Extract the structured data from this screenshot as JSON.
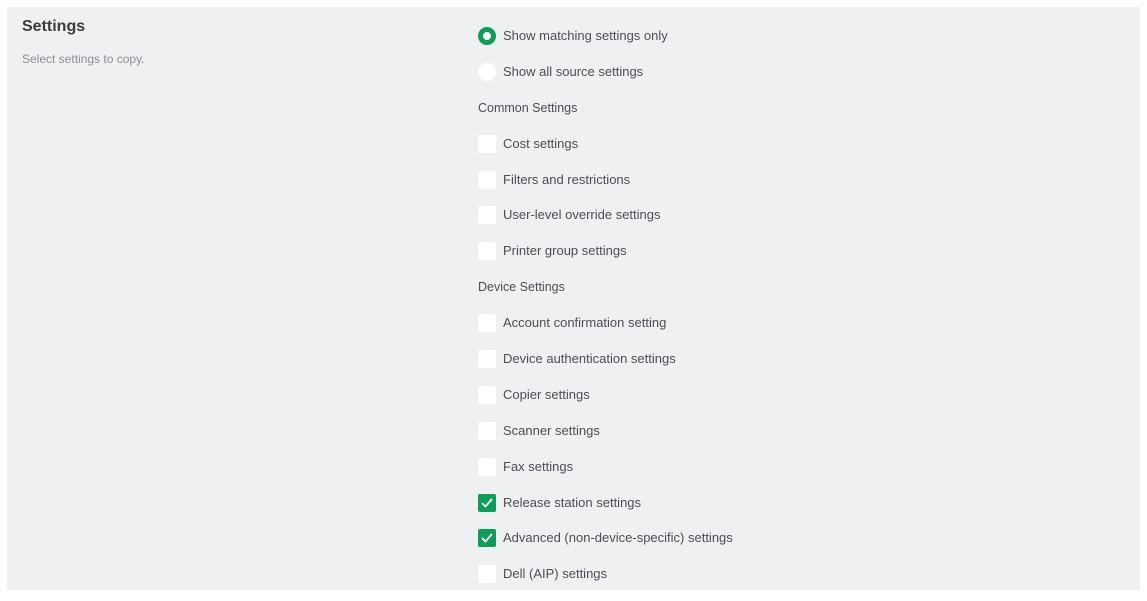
{
  "header": {
    "title": "Settings",
    "subtitle": "Select settings to copy."
  },
  "colors": {
    "accent": "#0c9d58",
    "panel_background": "#eff0f2"
  },
  "radio_options": [
    {
      "label": "Show matching settings only",
      "checked": true
    },
    {
      "label": "Show all source settings",
      "checked": false
    }
  ],
  "common_settings": {
    "heading": "Common Settings",
    "items": [
      {
        "label": "Cost settings",
        "checked": false
      },
      {
        "label": "Filters and restrictions",
        "checked": false
      },
      {
        "label": "User-level override settings",
        "checked": false
      },
      {
        "label": "Printer group settings",
        "checked": false
      }
    ]
  },
  "device_settings": {
    "heading": "Device Settings",
    "items": [
      {
        "label": "Account confirmation setting",
        "checked": false
      },
      {
        "label": "Device authentication settings",
        "checked": false
      },
      {
        "label": "Copier settings",
        "checked": false
      },
      {
        "label": "Scanner settings",
        "checked": false
      },
      {
        "label": "Fax settings",
        "checked": false
      },
      {
        "label": "Release station settings",
        "checked": true
      },
      {
        "label": "Advanced (non-device-specific) settings",
        "checked": true
      },
      {
        "label": "Dell (AIP) settings",
        "checked": false
      }
    ]
  }
}
